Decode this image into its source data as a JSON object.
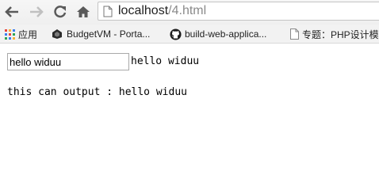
{
  "browser": {
    "url_host": "localhost",
    "url_path": "/4.html"
  },
  "bookmarks": [
    {
      "label": "应用",
      "icon": "apps-grid-icon"
    },
    {
      "label": "BudgetVM - Porta...",
      "icon": "budgetvm-logo-icon"
    },
    {
      "label": "build-web-applica...",
      "icon": "github-icon"
    },
    {
      "label": "专题：PHP设计模",
      "icon": "page-icon"
    }
  ],
  "page": {
    "input_value": "hello widuu",
    "echo_text": "hello widuu",
    "output_text": "this can output : hello widuu"
  }
}
